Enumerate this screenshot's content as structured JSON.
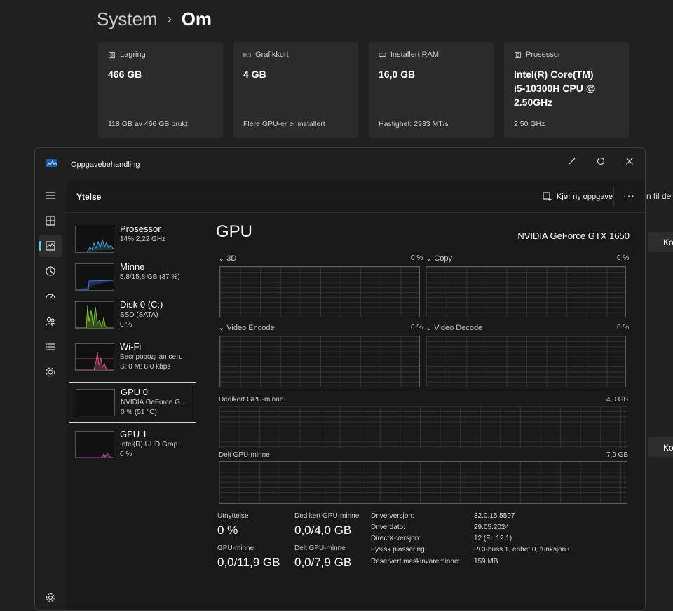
{
  "settings": {
    "breadcrumb": {
      "parent": "System",
      "separator": "›",
      "current": "Om"
    },
    "cards": [
      {
        "label": "Lagring",
        "value": "466 GB",
        "sub": "118 GB av 466 GB brukt",
        "icon": "storage-icon"
      },
      {
        "label": "Grafikkort",
        "value": "4 GB",
        "sub": "Flere GPU-er er installert",
        "icon": "graphics-card-icon"
      },
      {
        "label": "Installert RAM",
        "value": "16,0 GB",
        "sub": "Hastighet: 2933 MT/s",
        "icon": "ram-icon"
      },
      {
        "label": "Prosessor",
        "value": "Intel(R) Core(TM) i5-10300H CPU @ 2.50GHz",
        "sub": "2.50 GHz",
        "icon": "processor-icon"
      }
    ],
    "partial_text": "n til de",
    "partial_buttons": [
      "Ko",
      "Ko"
    ]
  },
  "taskmanager": {
    "title": "Oppgavebehandling",
    "section_title": "Ytelse",
    "run_task_label": "Kjør ny oppgave",
    "more_label": "···",
    "nav_icons": [
      "hamburger-icon",
      "processes-icon",
      "performance-icon",
      "app-history-icon",
      "startup-icon",
      "users-icon",
      "details-icon",
      "services-icon",
      "settings-icon"
    ],
    "devices": [
      {
        "name": "Prosessor",
        "line1": "14%  2,22 GHz",
        "line2": "",
        "color": "#4aa8d8"
      },
      {
        "name": "Minne",
        "line1": "5,8/15,8 GB (37 %)",
        "line2": "",
        "color": "#3d79cf"
      },
      {
        "name": "Disk 0 (C:)",
        "line1": "SSD (SATA)",
        "line2": "0 %",
        "color": "#7cc33a"
      },
      {
        "name": "Wi-Fi",
        "line1": "Беспроводная сеть",
        "line2": "S: 0  M: 8,0 kbps",
        "color": "#d05a8a"
      },
      {
        "name": "GPU 0",
        "line1": "NVIDIA GeForce G...",
        "line2": "0 %  (51 °C)",
        "color": "#8b5cc4"
      },
      {
        "name": "GPU 1",
        "line1": "Intel(R) UHD Grap...",
        "line2": "0 %",
        "color": "#b050b8"
      }
    ],
    "gpu": {
      "title": "GPU",
      "model": "NVIDIA GeForce GTX 1650",
      "engines": [
        {
          "name": "3D",
          "value": "0 %"
        },
        {
          "name": "Copy",
          "value": "0 %"
        },
        {
          "name": "Video Encode",
          "value": "0 %"
        },
        {
          "name": "Video Decode",
          "value": "0 %"
        }
      ],
      "dedicated_label": "Dedikert GPU-minne",
      "dedicated_max": "4,0 GB",
      "shared_label": "Delt GPU-minne",
      "shared_max": "7,9 GB",
      "stats": [
        {
          "label": "Utnyttelse",
          "value": "0 %"
        },
        {
          "label": "Dedikert GPU-minne",
          "value": "0,0/4,0 GB"
        },
        {
          "label": "GPU-minne",
          "value": "0,0/11,9 GB"
        },
        {
          "label": "Delt GPU-minne",
          "value": "0,0/7,9 GB"
        }
      ],
      "details": [
        {
          "k": "Driverversjon:",
          "v": "32.0.15.5597"
        },
        {
          "k": "Driverdato:",
          "v": "29.05.2024"
        },
        {
          "k": "DirectX-versjon:",
          "v": "12 (FL 12.1)"
        },
        {
          "k": "Fysisk plassering:",
          "v": "PCI-buss 1, enhet 0, funksjon 0"
        },
        {
          "k": "Reservert maskinvareminne:",
          "v": "159 MB"
        }
      ]
    }
  }
}
